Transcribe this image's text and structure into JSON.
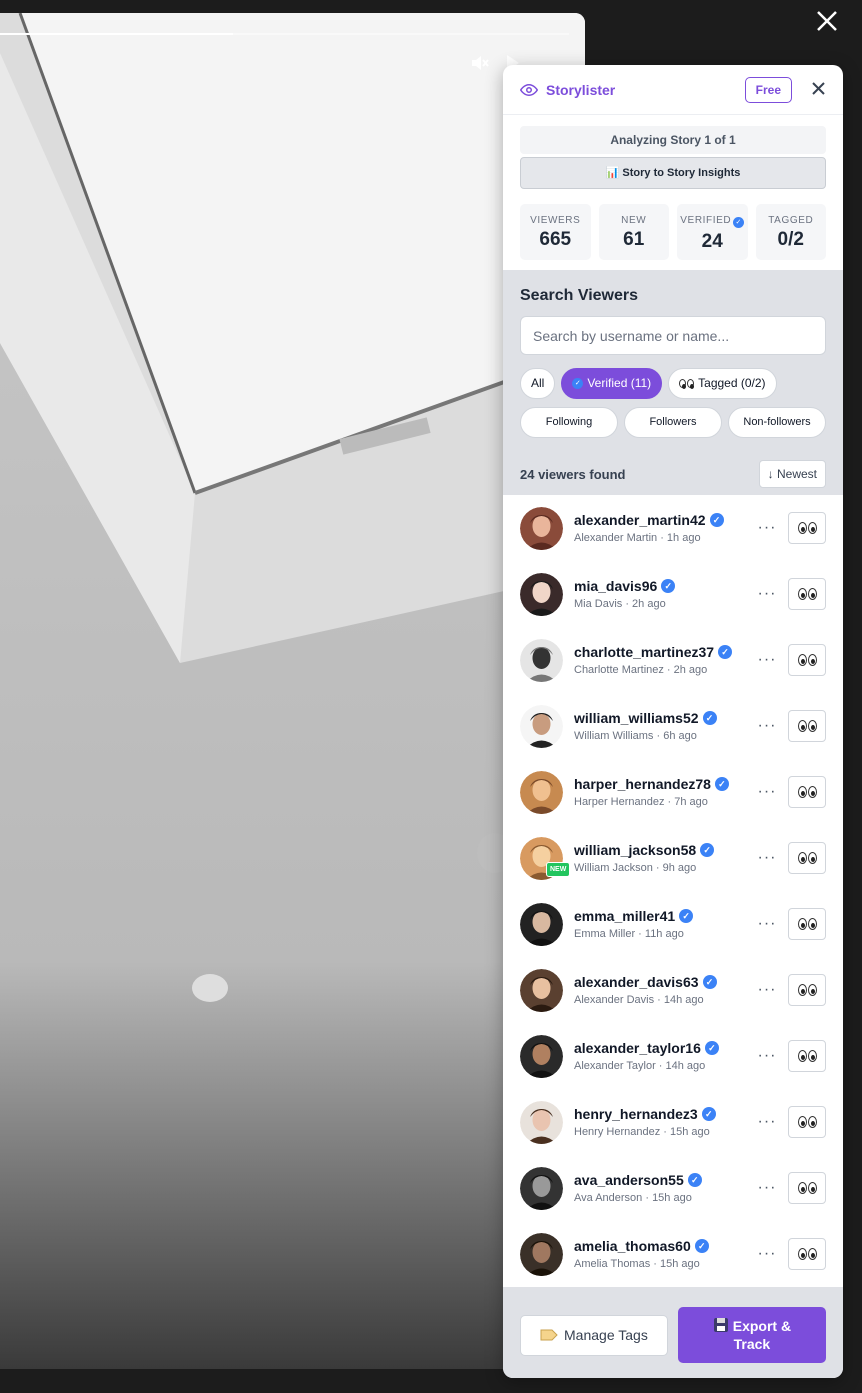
{
  "story": {
    "progress_fraction": 0.41
  },
  "panel": {
    "brand": "Storylister",
    "plan_badge": "Free",
    "analyzing_text": "Analyzing Story 1 of 1",
    "insights_button": "📊 Story to Story Insights"
  },
  "stats": [
    {
      "label": "VIEWERS",
      "value": "665"
    },
    {
      "label": "NEW",
      "value": "61"
    },
    {
      "label": "VERIFIED",
      "value": "24"
    },
    {
      "label": "TAGGED",
      "value": "0/2"
    }
  ],
  "search": {
    "title": "Search Viewers",
    "placeholder": "Search by username or name..."
  },
  "filters": {
    "all": "All",
    "verified": "Verified (11)",
    "tagged": "Tagged (0/2)",
    "following": "Following",
    "followers": "Followers",
    "non_followers": "Non-followers"
  },
  "results": {
    "count_text": "24 viewers found",
    "sort_label": "↓ Newest"
  },
  "viewers": [
    {
      "username": "alexander_martin42",
      "meta": "Alexander Martin · 1h ago",
      "is_new": false
    },
    {
      "username": "mia_davis96",
      "meta": "Mia Davis · 2h ago",
      "is_new": false
    },
    {
      "username": "charlotte_martinez37",
      "meta": "Charlotte Martinez · 2h ago",
      "is_new": false
    },
    {
      "username": "william_williams52",
      "meta": "William Williams · 6h ago",
      "is_new": false
    },
    {
      "username": "harper_hernandez78",
      "meta": "Harper Hernandez · 7h ago",
      "is_new": false
    },
    {
      "username": "william_jackson58",
      "meta": "William Jackson · 9h ago",
      "is_new": true
    },
    {
      "username": "emma_miller41",
      "meta": "Emma Miller · 11h ago",
      "is_new": false
    },
    {
      "username": "alexander_davis63",
      "meta": "Alexander Davis · 14h ago",
      "is_new": false
    },
    {
      "username": "alexander_taylor16",
      "meta": "Alexander Taylor · 14h ago",
      "is_new": false
    },
    {
      "username": "henry_hernandez3",
      "meta": "Henry Hernandez · 15h ago",
      "is_new": false
    },
    {
      "username": "ava_anderson55",
      "meta": "Ava Anderson · 15h ago",
      "is_new": false
    },
    {
      "username": "amelia_thomas60",
      "meta": "Amelia Thomas · 15h ago",
      "is_new": false
    }
  ],
  "new_badge": "NEW",
  "footer": {
    "manage_tags": "Manage Tags",
    "export": "Export & Track"
  },
  "colors": {
    "accent": "#7c4ddb",
    "verified": "#3b82f6",
    "new_badge": "#22c55e"
  }
}
